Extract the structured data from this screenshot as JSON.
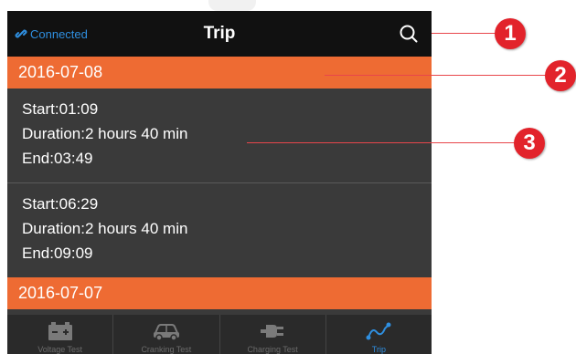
{
  "header": {
    "connection_status": "Connected",
    "title": "Trip"
  },
  "groups": [
    {
      "date": "2016-07-08",
      "trips": [
        {
          "start": "Start:01:09",
          "duration": "Duration:2 hours 40 min",
          "end": "End:03:49"
        },
        {
          "start": "Start:06:29",
          "duration": "Duration:2 hours 40 min",
          "end": "End:09:09"
        }
      ]
    },
    {
      "date": "2016-07-07",
      "trips": []
    }
  ],
  "tabs": [
    {
      "label": "Voltage Test",
      "icon": "battery-icon"
    },
    {
      "label": "Cranking Test",
      "icon": "car-icon"
    },
    {
      "label": "Charging Test",
      "icon": "charger-plug-icon"
    },
    {
      "label": "Trip",
      "icon": "trip-route-icon",
      "active": true
    }
  ],
  "callouts": [
    "1",
    "2",
    "3"
  ],
  "colors": {
    "accent_orange": "#ee6b33",
    "link_blue": "#2f8fe0",
    "callout_red": "#e2232b",
    "background_dark": "#3a3a3a",
    "header_black": "#111111"
  }
}
